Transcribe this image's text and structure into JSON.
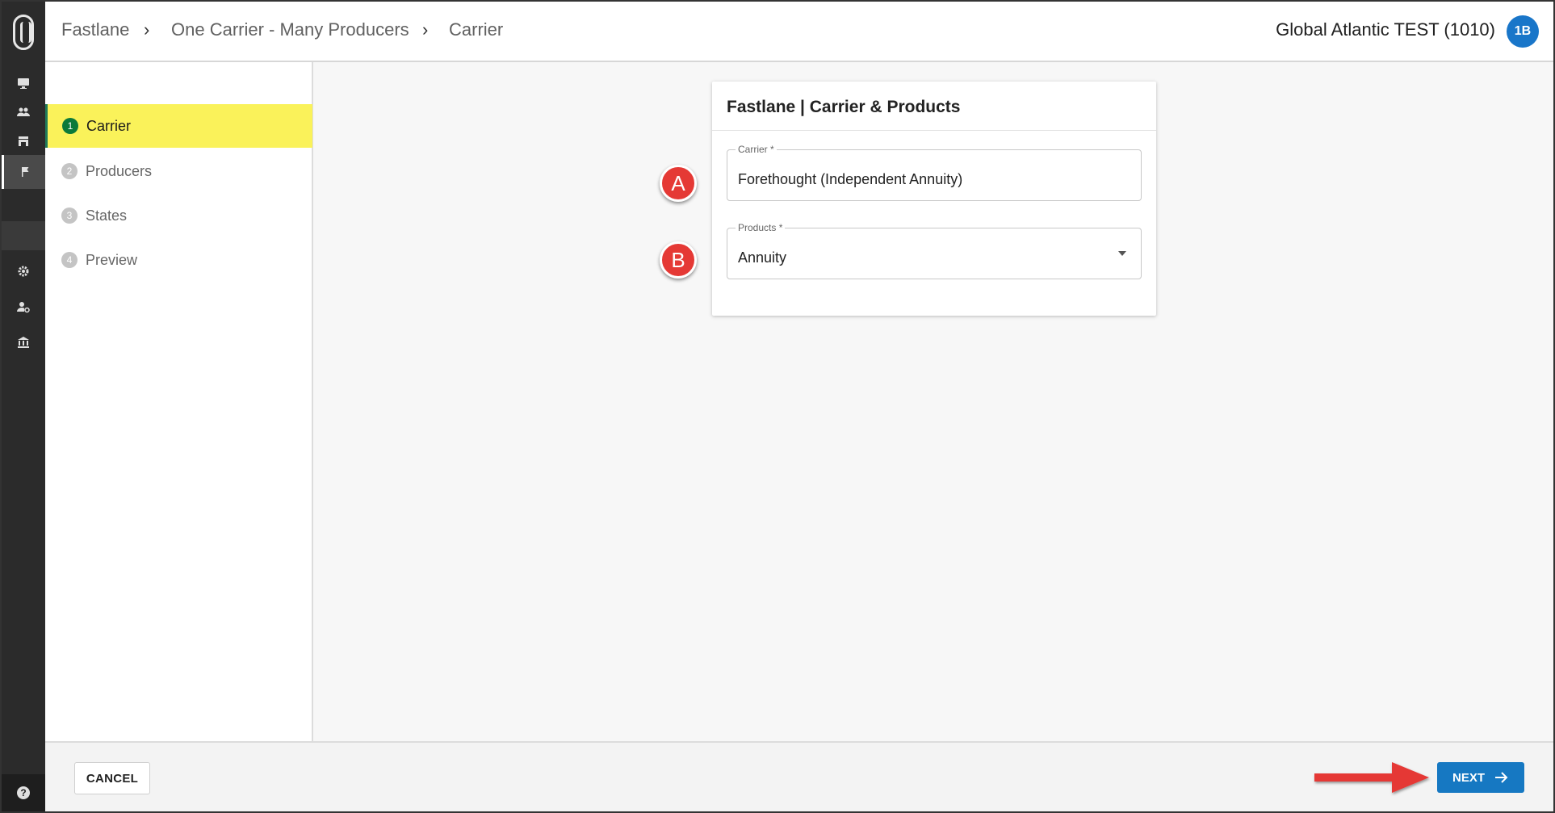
{
  "header": {
    "breadcrumbs": [
      "Fastlane",
      "One Carrier - Many Producers",
      "Carrier"
    ],
    "org_name": "Global Atlantic TEST (1010)",
    "avatar_initials": "1B"
  },
  "rail": {
    "items": [
      "monitor-icon",
      "people-icon",
      "store-icon",
      "flag-icon",
      "gear-icon",
      "user-settings-icon",
      "bank-icon"
    ],
    "active_item": "flag-icon",
    "help": "?"
  },
  "steps": [
    {
      "number": "1",
      "label": "Carrier",
      "active": true
    },
    {
      "number": "2",
      "label": "Producers",
      "active": false
    },
    {
      "number": "3",
      "label": "States",
      "active": false
    },
    {
      "number": "4",
      "label": "Preview",
      "active": false
    }
  ],
  "card": {
    "title": "Fastlane | Carrier & Products",
    "carrier": {
      "label": "Carrier *",
      "value": "Forethought (Independent Annuity)"
    },
    "products": {
      "label": "Products *",
      "value": "Annuity"
    }
  },
  "markers": [
    "A",
    "B"
  ],
  "footer": {
    "cancel_label": "CANCEL",
    "next_label": "NEXT"
  },
  "colors": {
    "accent": "#1678c2",
    "active_step_bg": "#faf25a",
    "marker_red": "#e53935",
    "rail_bg": "#2b2b2b"
  }
}
